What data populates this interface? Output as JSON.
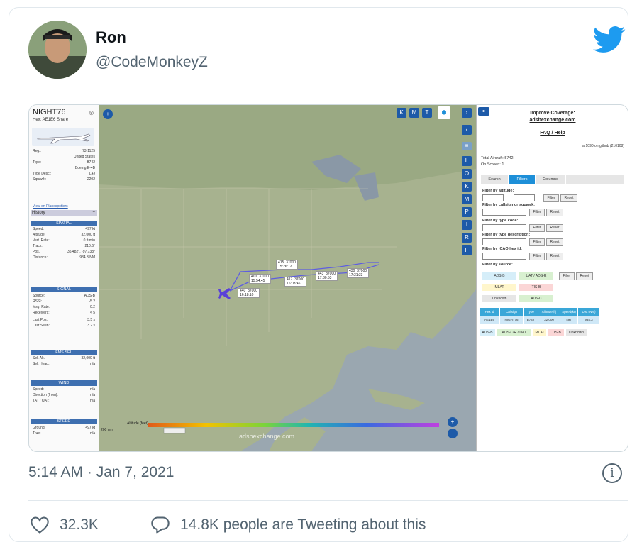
{
  "tweet": {
    "author_name": "Ron",
    "author_handle": "@CodeMonkeyZ",
    "timestamp": "5:14 AM · Jan 7, 2021",
    "likes": "32.3K",
    "replies": "14.8K people are Tweeting about this",
    "info_glyph": "i"
  },
  "colors": {
    "twitter_blue": "#1d9bf0",
    "muted": "#536471",
    "text": "#0f1419"
  },
  "screenshot": {
    "left_panel": {
      "callsign": "NIGHT76",
      "sub": "Hex: AE1E6 Share",
      "history": "History",
      "sections": [
        "SPATIAL",
        "SIGNAL",
        "FMS SEL",
        "WIND",
        "SPEED"
      ],
      "rows": [
        {
          "k": "Reg.:",
          "v": "73-1125"
        },
        {
          "k": "",
          "v": "United States"
        },
        {
          "k": "Type:",
          "v": "B742"
        },
        {
          "k": "",
          "v": "Boeing E-4B"
        },
        {
          "k": "Type Desc.:",
          "v": "L4J"
        },
        {
          "k": "Squawk:",
          "v": "2202"
        },
        {
          "k": "Speed:",
          "v": "497 kt"
        },
        {
          "k": "Altitude:",
          "v": "32,000 ft"
        },
        {
          "k": "Vert. Rate:",
          "v": "0 ft/min"
        },
        {
          "k": "Track:",
          "v": "210.6°"
        },
        {
          "k": "Pos.:",
          "v": "35.482°, -97.738°"
        },
        {
          "k": "Distance:",
          "v": "934.3 NM"
        },
        {
          "k": "Source:",
          "v": "ADS-B"
        },
        {
          "k": "RSSI:",
          "v": "-5.2"
        },
        {
          "k": "Msg. Rate:",
          "v": "0.2"
        },
        {
          "k": "Receivers:",
          "v": "< 5"
        },
        {
          "k": "Last Pos.:",
          "v": "3.5 s"
        },
        {
          "k": "Last Seen:",
          "v": "3.2 s"
        },
        {
          "k": "Sel. Alt.:",
          "v": "32,000 ft"
        },
        {
          "k": "Sel. Head.:",
          "v": "n/a"
        },
        {
          "k": "Speed:",
          "v": "n/a"
        },
        {
          "k": "Direction (from):",
          "v": "n/a"
        },
        {
          "k": "TAT / OAT:",
          "v": "n/a"
        },
        {
          "k": "Ground:",
          "v": "497 kt"
        },
        {
          "k": "True:",
          "v": "n/a"
        }
      ],
      "view_link": "View on Planespotters"
    },
    "map": {
      "track_labels": [
        "415  37000\n15:26:12",
        "400  37000\n15:54:45",
        "417  37000\n16:03:46",
        "440  37000\n16:18:10",
        "443  37000\n17:30:53",
        "430  37000\n17:31:33"
      ],
      "altitude_label": "Altitude (feet)",
      "scale_label": "200 nm",
      "watermark": "adsbexchange.com",
      "layer_buttons": [
        "K",
        "M",
        "T"
      ],
      "side_buttons": [
        "L",
        "O",
        "K",
        "M",
        "P",
        "I",
        "R",
        "F"
      ]
    },
    "right_panel": {
      "improve": "Improve Coverage:",
      "site": "adsbexchange.com",
      "faq": "FAQ / Help",
      "version": "tar1090 on github (210108)",
      "total_aircraft": "Total Aircraft: 5742",
      "on_screen": "On Screen: 1",
      "tabs": [
        "Search",
        "Filters",
        "Columns"
      ],
      "filter_labels": [
        "Filter by altitude:",
        "Filter by callsign or squawk:",
        "Filter by type code:",
        "Filter by type description:",
        "Filter by ICAO hex id:",
        "Filter by source:"
      ],
      "filter_btn": "Filter",
      "reset_btn": "Reset",
      "sources": [
        "ADS-B",
        "UAT / ADS-R",
        "MLAT",
        "TIS-B",
        "Unknown",
        "ADS-C"
      ],
      "table_headers": [
        "Hex id",
        "Callsign",
        "Type",
        "Altitude(ft)",
        "Speed(kt)",
        "Dist (NM)"
      ],
      "table_row": [
        "AE1E6",
        "NIGHT76",
        "B742",
        "32,000",
        "497",
        "934.3"
      ],
      "legend": [
        "ADS-B",
        "ADS-C/R / UAT",
        "MLAT",
        "TIS-B",
        "Unknown"
      ]
    }
  }
}
